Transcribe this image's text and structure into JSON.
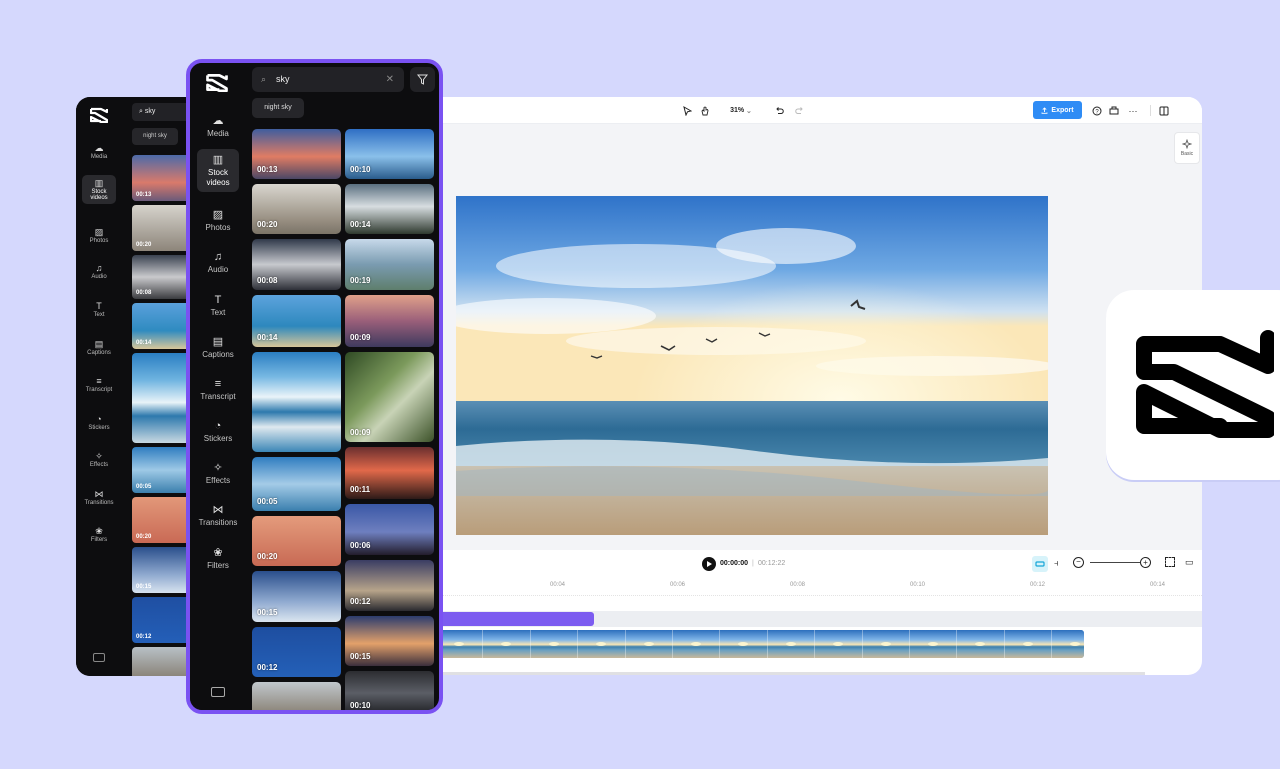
{
  "editor": {
    "toolbar": {
      "zoom": "31%",
      "export_label": "Export",
      "icons": [
        "pointer-icon",
        "hand-icon",
        "undo-icon",
        "redo-icon",
        "help-icon",
        "keyboard-icon",
        "more-icon",
        "layout-icon"
      ]
    },
    "side_tool": {
      "label": "Basic"
    },
    "playback": {
      "current_time": "00:00:00",
      "separator": "|",
      "total_time": "00:12:22"
    },
    "ruler_ticks": [
      "00:04",
      "00:06",
      "00:08",
      "00:10",
      "00:12",
      "00:14"
    ]
  },
  "back_panel": {
    "search_value": "sky",
    "chip": "night sky",
    "nav": [
      {
        "label": "Media",
        "icon": "cloud-upload-icon"
      },
      {
        "label": "Stock videos",
        "icon": "film-icon",
        "active": true
      },
      {
        "label": "Photos",
        "icon": "image-icon"
      },
      {
        "label": "Audio",
        "icon": "music-icon"
      },
      {
        "label": "Text",
        "icon": "text-icon"
      },
      {
        "label": "Captions",
        "icon": "captions-icon"
      },
      {
        "label": "Transcript",
        "icon": "transcript-icon"
      },
      {
        "label": "Stickers",
        "icon": "sticker-icon"
      },
      {
        "label": "Effects",
        "icon": "sparkle-icon"
      },
      {
        "label": "Transitions",
        "icon": "transition-icon"
      },
      {
        "label": "Filters",
        "icon": "filters-icon"
      }
    ],
    "thumbs": [
      "00:13",
      "00:20",
      "00:08",
      "00:14",
      "",
      "00:05",
      "00:20",
      "00:15",
      "00:12",
      ""
    ]
  },
  "front_panel": {
    "search_value": "sky",
    "chip": "night sky",
    "nav": [
      {
        "label": "Media",
        "icon": "cloud-upload-icon"
      },
      {
        "label": "Stock videos",
        "icon": "film-icon",
        "active": true
      },
      {
        "label": "Photos",
        "icon": "image-icon"
      },
      {
        "label": "Audio",
        "icon": "music-icon"
      },
      {
        "label": "Text",
        "icon": "text-icon"
      },
      {
        "label": "Captions",
        "icon": "captions-icon"
      },
      {
        "label": "Transcript",
        "icon": "transcript-icon"
      },
      {
        "label": "Stickers",
        "icon": "sticker-icon"
      },
      {
        "label": "Effects",
        "icon": "sparkle-icon"
      },
      {
        "label": "Transitions",
        "icon": "transition-icon"
      },
      {
        "label": "Filters",
        "icon": "filters-icon"
      }
    ],
    "grid_left": [
      "00:13",
      "00:20",
      "00:08",
      "00:14",
      "",
      "00:05",
      "00:20",
      "00:15",
      "00:12",
      ""
    ],
    "grid_right": [
      "00:10",
      "00:14",
      "00:19",
      "00:09",
      "00:09",
      "00:11",
      "00:06",
      "00:12",
      "00:15",
      "00:10"
    ]
  },
  "colors": {
    "accent": "#7a52f2",
    "export": "#2f8cf5",
    "background": "#d5d8fd",
    "panel": "#0d0d0f"
  }
}
